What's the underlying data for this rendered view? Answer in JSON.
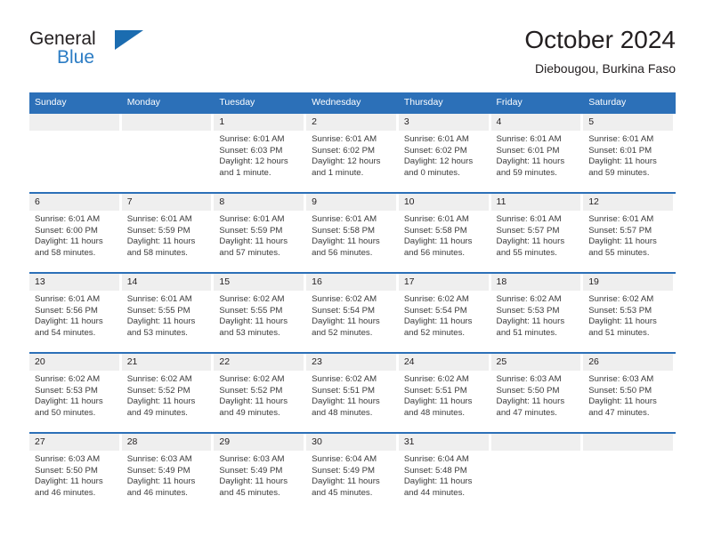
{
  "brand": {
    "name_part1": "General",
    "name_part2": "Blue",
    "triangle_icon": "blue-triangle-icon",
    "accent_color": "#2b7cc4"
  },
  "header": {
    "title": "October 2024",
    "subtitle": "Diebougou, Burkina Faso"
  },
  "colors": {
    "header_blue": "#2c70b8",
    "row_divider_blue": "#2c70b8",
    "day_band_gray": "#efefef",
    "text": "#231f20"
  },
  "calendar": {
    "weekday_headers": [
      "Sunday",
      "Monday",
      "Tuesday",
      "Wednesday",
      "Thursday",
      "Friday",
      "Saturday"
    ],
    "weeks": [
      [
        {
          "day": "",
          "sunrise": "",
          "sunset": "",
          "daylight_line1": "",
          "daylight_line2": ""
        },
        {
          "day": "",
          "sunrise": "",
          "sunset": "",
          "daylight_line1": "",
          "daylight_line2": ""
        },
        {
          "day": "1",
          "sunrise": "Sunrise: 6:01 AM",
          "sunset": "Sunset: 6:03 PM",
          "daylight_line1": "Daylight: 12 hours",
          "daylight_line2": "and 1 minute."
        },
        {
          "day": "2",
          "sunrise": "Sunrise: 6:01 AM",
          "sunset": "Sunset: 6:02 PM",
          "daylight_line1": "Daylight: 12 hours",
          "daylight_line2": "and 1 minute."
        },
        {
          "day": "3",
          "sunrise": "Sunrise: 6:01 AM",
          "sunset": "Sunset: 6:02 PM",
          "daylight_line1": "Daylight: 12 hours",
          "daylight_line2": "and 0 minutes."
        },
        {
          "day": "4",
          "sunrise": "Sunrise: 6:01 AM",
          "sunset": "Sunset: 6:01 PM",
          "daylight_line1": "Daylight: 11 hours",
          "daylight_line2": "and 59 minutes."
        },
        {
          "day": "5",
          "sunrise": "Sunrise: 6:01 AM",
          "sunset": "Sunset: 6:01 PM",
          "daylight_line1": "Daylight: 11 hours",
          "daylight_line2": "and 59 minutes."
        }
      ],
      [
        {
          "day": "6",
          "sunrise": "Sunrise: 6:01 AM",
          "sunset": "Sunset: 6:00 PM",
          "daylight_line1": "Daylight: 11 hours",
          "daylight_line2": "and 58 minutes."
        },
        {
          "day": "7",
          "sunrise": "Sunrise: 6:01 AM",
          "sunset": "Sunset: 5:59 PM",
          "daylight_line1": "Daylight: 11 hours",
          "daylight_line2": "and 58 minutes."
        },
        {
          "day": "8",
          "sunrise": "Sunrise: 6:01 AM",
          "sunset": "Sunset: 5:59 PM",
          "daylight_line1": "Daylight: 11 hours",
          "daylight_line2": "and 57 minutes."
        },
        {
          "day": "9",
          "sunrise": "Sunrise: 6:01 AM",
          "sunset": "Sunset: 5:58 PM",
          "daylight_line1": "Daylight: 11 hours",
          "daylight_line2": "and 56 minutes."
        },
        {
          "day": "10",
          "sunrise": "Sunrise: 6:01 AM",
          "sunset": "Sunset: 5:58 PM",
          "daylight_line1": "Daylight: 11 hours",
          "daylight_line2": "and 56 minutes."
        },
        {
          "day": "11",
          "sunrise": "Sunrise: 6:01 AM",
          "sunset": "Sunset: 5:57 PM",
          "daylight_line1": "Daylight: 11 hours",
          "daylight_line2": "and 55 minutes."
        },
        {
          "day": "12",
          "sunrise": "Sunrise: 6:01 AM",
          "sunset": "Sunset: 5:57 PM",
          "daylight_line1": "Daylight: 11 hours",
          "daylight_line2": "and 55 minutes."
        }
      ],
      [
        {
          "day": "13",
          "sunrise": "Sunrise: 6:01 AM",
          "sunset": "Sunset: 5:56 PM",
          "daylight_line1": "Daylight: 11 hours",
          "daylight_line2": "and 54 minutes."
        },
        {
          "day": "14",
          "sunrise": "Sunrise: 6:01 AM",
          "sunset": "Sunset: 5:55 PM",
          "daylight_line1": "Daylight: 11 hours",
          "daylight_line2": "and 53 minutes."
        },
        {
          "day": "15",
          "sunrise": "Sunrise: 6:02 AM",
          "sunset": "Sunset: 5:55 PM",
          "daylight_line1": "Daylight: 11 hours",
          "daylight_line2": "and 53 minutes."
        },
        {
          "day": "16",
          "sunrise": "Sunrise: 6:02 AM",
          "sunset": "Sunset: 5:54 PM",
          "daylight_line1": "Daylight: 11 hours",
          "daylight_line2": "and 52 minutes."
        },
        {
          "day": "17",
          "sunrise": "Sunrise: 6:02 AM",
          "sunset": "Sunset: 5:54 PM",
          "daylight_line1": "Daylight: 11 hours",
          "daylight_line2": "and 52 minutes."
        },
        {
          "day": "18",
          "sunrise": "Sunrise: 6:02 AM",
          "sunset": "Sunset: 5:53 PM",
          "daylight_line1": "Daylight: 11 hours",
          "daylight_line2": "and 51 minutes."
        },
        {
          "day": "19",
          "sunrise": "Sunrise: 6:02 AM",
          "sunset": "Sunset: 5:53 PM",
          "daylight_line1": "Daylight: 11 hours",
          "daylight_line2": "and 51 minutes."
        }
      ],
      [
        {
          "day": "20",
          "sunrise": "Sunrise: 6:02 AM",
          "sunset": "Sunset: 5:53 PM",
          "daylight_line1": "Daylight: 11 hours",
          "daylight_line2": "and 50 minutes."
        },
        {
          "day": "21",
          "sunrise": "Sunrise: 6:02 AM",
          "sunset": "Sunset: 5:52 PM",
          "daylight_line1": "Daylight: 11 hours",
          "daylight_line2": "and 49 minutes."
        },
        {
          "day": "22",
          "sunrise": "Sunrise: 6:02 AM",
          "sunset": "Sunset: 5:52 PM",
          "daylight_line1": "Daylight: 11 hours",
          "daylight_line2": "and 49 minutes."
        },
        {
          "day": "23",
          "sunrise": "Sunrise: 6:02 AM",
          "sunset": "Sunset: 5:51 PM",
          "daylight_line1": "Daylight: 11 hours",
          "daylight_line2": "and 48 minutes."
        },
        {
          "day": "24",
          "sunrise": "Sunrise: 6:02 AM",
          "sunset": "Sunset: 5:51 PM",
          "daylight_line1": "Daylight: 11 hours",
          "daylight_line2": "and 48 minutes."
        },
        {
          "day": "25",
          "sunrise": "Sunrise: 6:03 AM",
          "sunset": "Sunset: 5:50 PM",
          "daylight_line1": "Daylight: 11 hours",
          "daylight_line2": "and 47 minutes."
        },
        {
          "day": "26",
          "sunrise": "Sunrise: 6:03 AM",
          "sunset": "Sunset: 5:50 PM",
          "daylight_line1": "Daylight: 11 hours",
          "daylight_line2": "and 47 minutes."
        }
      ],
      [
        {
          "day": "27",
          "sunrise": "Sunrise: 6:03 AM",
          "sunset": "Sunset: 5:50 PM",
          "daylight_line1": "Daylight: 11 hours",
          "daylight_line2": "and 46 minutes."
        },
        {
          "day": "28",
          "sunrise": "Sunrise: 6:03 AM",
          "sunset": "Sunset: 5:49 PM",
          "daylight_line1": "Daylight: 11 hours",
          "daylight_line2": "and 46 minutes."
        },
        {
          "day": "29",
          "sunrise": "Sunrise: 6:03 AM",
          "sunset": "Sunset: 5:49 PM",
          "daylight_line1": "Daylight: 11 hours",
          "daylight_line2": "and 45 minutes."
        },
        {
          "day": "30",
          "sunrise": "Sunrise: 6:04 AM",
          "sunset": "Sunset: 5:49 PM",
          "daylight_line1": "Daylight: 11 hours",
          "daylight_line2": "and 45 minutes."
        },
        {
          "day": "31",
          "sunrise": "Sunrise: 6:04 AM",
          "sunset": "Sunset: 5:48 PM",
          "daylight_line1": "Daylight: 11 hours",
          "daylight_line2": "and 44 minutes."
        },
        {
          "day": "",
          "sunrise": "",
          "sunset": "",
          "daylight_line1": "",
          "daylight_line2": ""
        },
        {
          "day": "",
          "sunrise": "",
          "sunset": "",
          "daylight_line1": "",
          "daylight_line2": ""
        }
      ]
    ]
  }
}
